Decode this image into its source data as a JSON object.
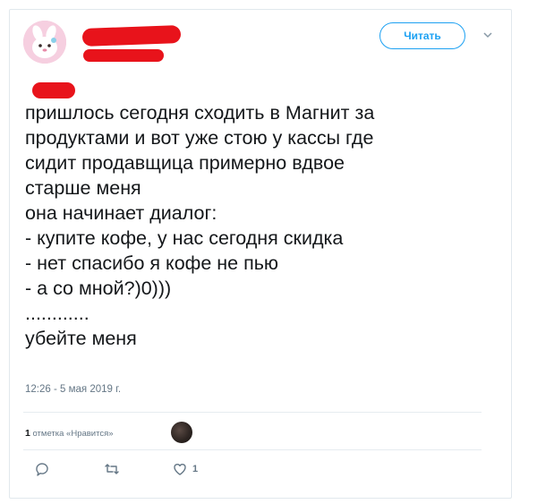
{
  "header": {
    "follow_label": "Читать"
  },
  "tweet": {
    "text": "пришлось сегодня сходить в Магнит за\nпродуктами и вот уже стою у кассы где\nсидит продавщица примерно вдвое\nстарше меня\nона начинает диалог:\n- купите кофе, у нас сегодня скидка\n- нет спасибо я кофе не пью\n- а со мной?)0)))\n............\nубейте меня",
    "timestamp": "12:26 - 5 мая 2019 г."
  },
  "engagement": {
    "like_count_label": "1",
    "like_text": "отметка «Нравится»"
  },
  "actions": {
    "reply_icon": "reply-icon",
    "retweet_icon": "retweet-icon",
    "like_icon": "like-icon",
    "like_count": "1"
  },
  "colors": {
    "accent": "#1da1f2",
    "text": "#14171a",
    "secondary": "#657786",
    "redaction": "#e8131b"
  }
}
